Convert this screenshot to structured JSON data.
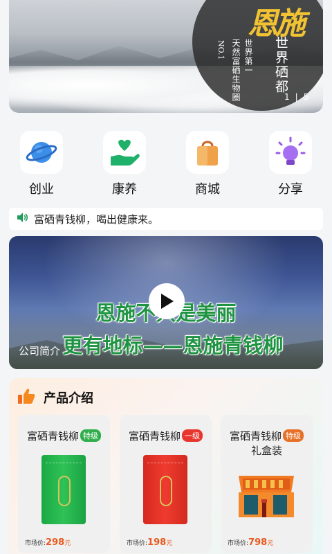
{
  "banner": {
    "calligraphy": "恩施",
    "vertical_1": "世界硒都",
    "vertical_2": "世界第一",
    "vertical_3": "天然富硒生物圈",
    "vertical_4": "NO.1",
    "pager_current": "1",
    "pager_total": "5"
  },
  "categories": [
    {
      "label": "创业",
      "icon": "planet-icon"
    },
    {
      "label": "康养",
      "icon": "heart-hand-icon"
    },
    {
      "label": "商城",
      "icon": "shopping-bag-icon"
    },
    {
      "label": "分享",
      "icon": "lightbulb-icon"
    }
  ],
  "notice": {
    "text": "富硒青钱柳，喝出健康来。",
    "icon": "speaker-icon"
  },
  "video": {
    "line1": "恩施不只是美丽",
    "line2": "更有地标——恩施青钱柳",
    "caption": "公司简介"
  },
  "products": {
    "title": "产品介绍",
    "items": [
      {
        "name": "富硒青钱柳",
        "grade": "特级",
        "grade_color": "#2fae4b",
        "sub": "",
        "price_label": "市场价:",
        "price": "298",
        "unit": "元",
        "pack_color": "#22b24a"
      },
      {
        "name": "富硒青钱柳",
        "grade": "一级",
        "grade_color": "#e8362f",
        "sub": "",
        "price_label": "市场价:",
        "price": "198",
        "unit": "元",
        "pack_color": "#e53a2c"
      },
      {
        "name": "富硒青钱柳",
        "grade": "特级",
        "grade_color": "#e86f26",
        "sub": "礼盒装",
        "price_label": "市场价:",
        "price": "798",
        "unit": "元",
        "pack_color": "#f07b22"
      }
    ]
  },
  "colors": {
    "accent": "#e9581e",
    "green": "#1e9442"
  }
}
